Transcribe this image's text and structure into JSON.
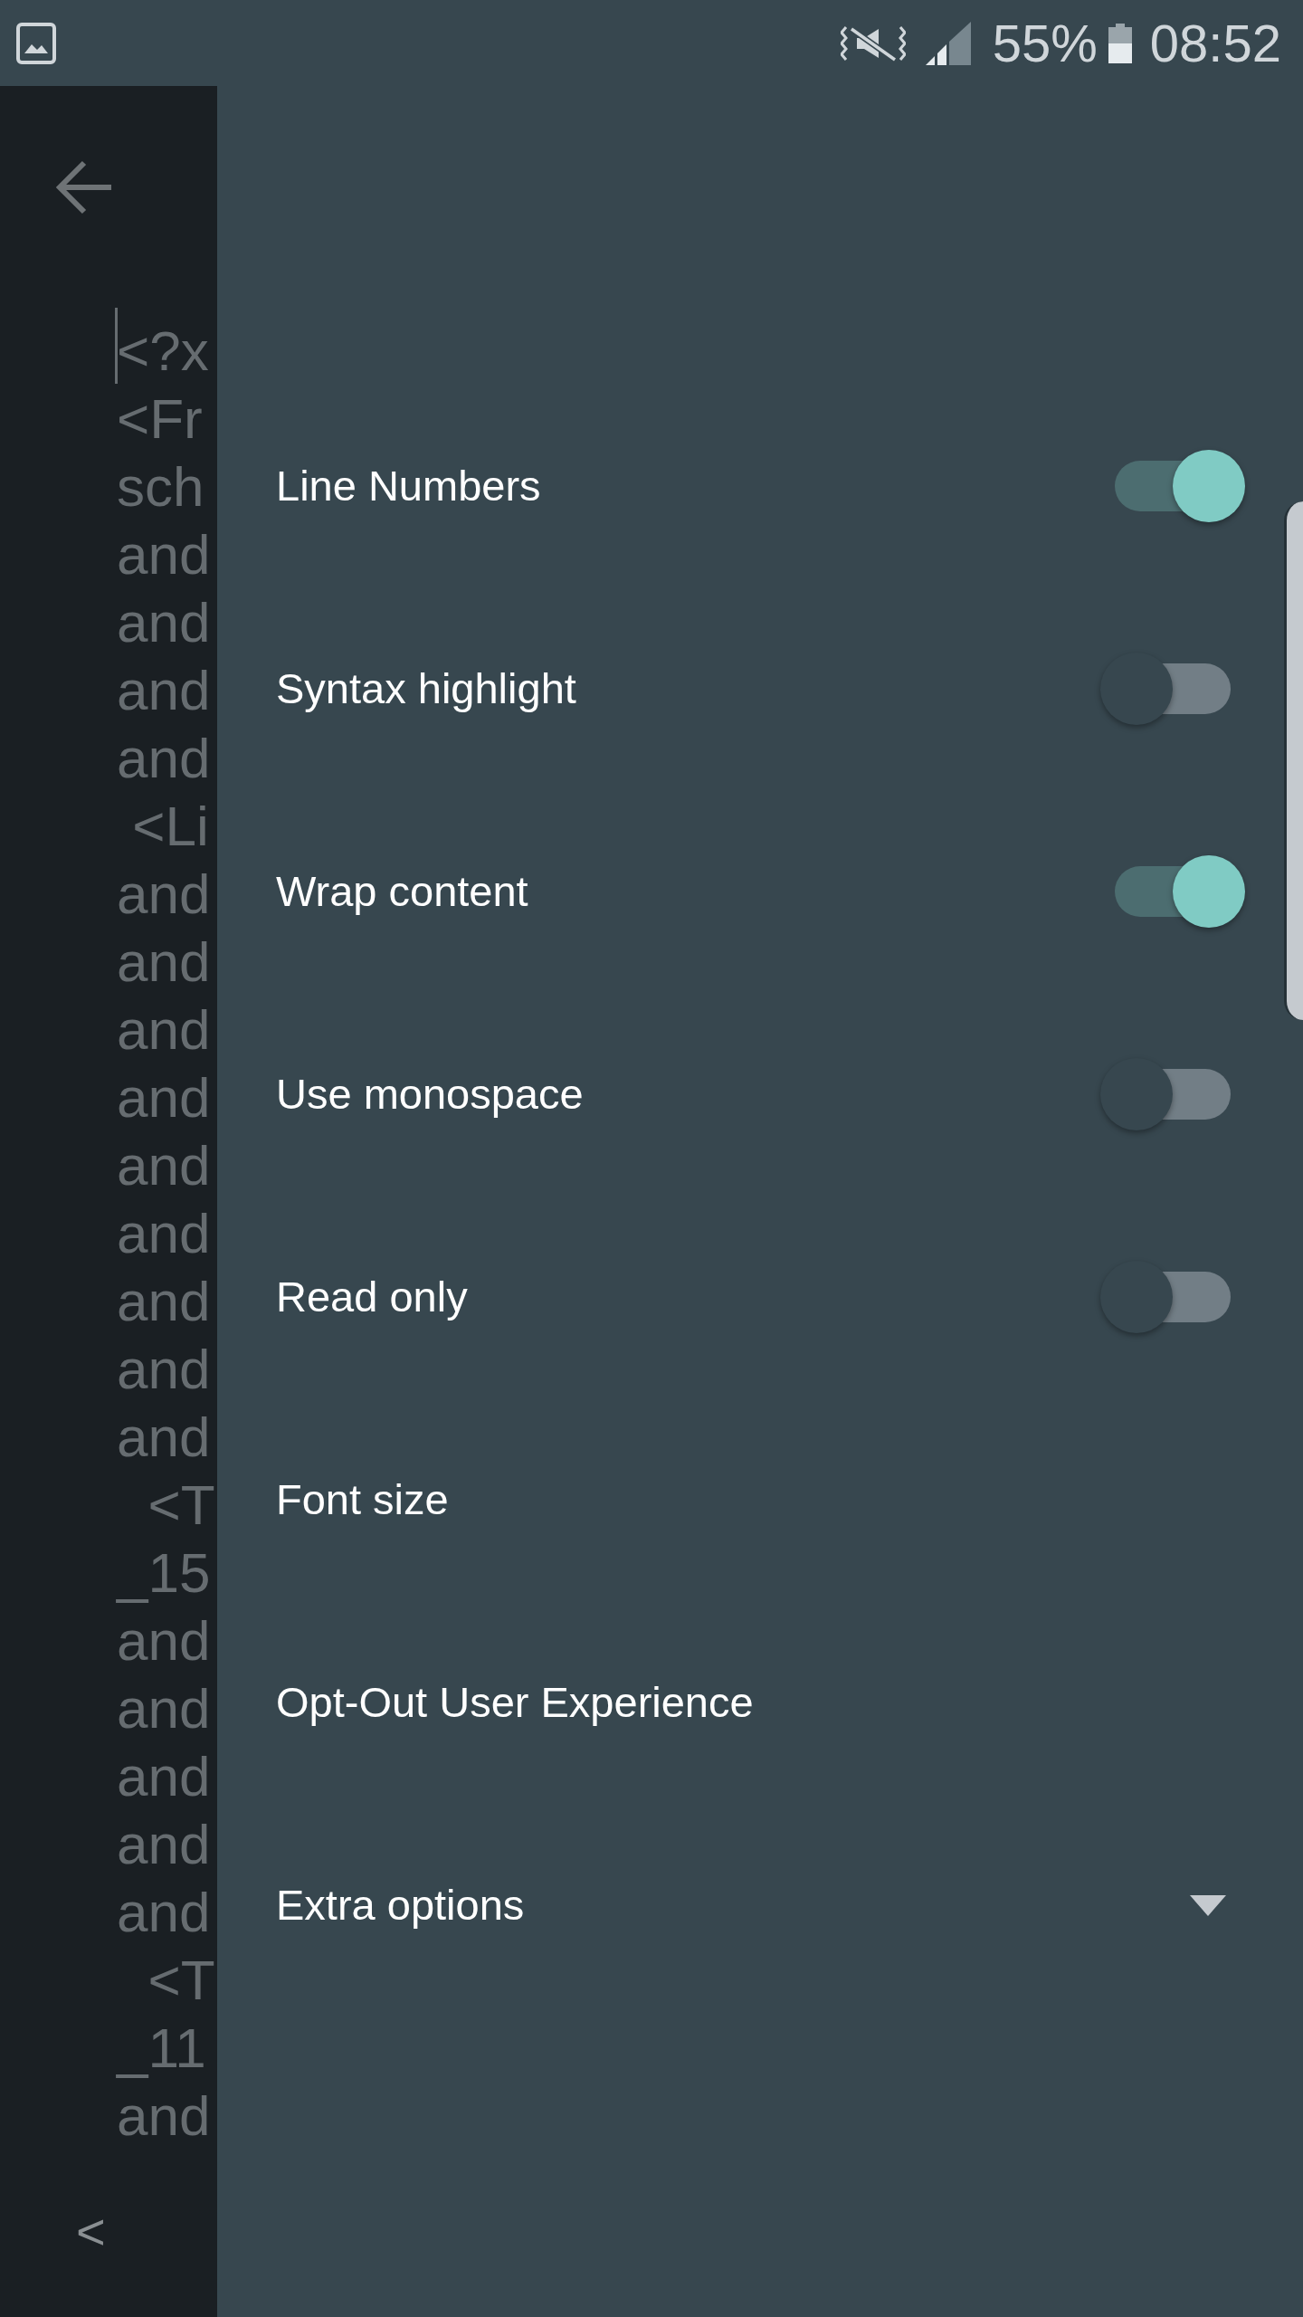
{
  "status_bar": {
    "battery": "55%",
    "time": "08:52"
  },
  "editor": {
    "lines": [
      {
        "text": "<?x",
        "cursor": true
      },
      {
        "text": "<Fr",
        "cursor": false
      },
      {
        "text": "sch",
        "cursor": false
      },
      {
        "text": "and",
        "cursor": false
      },
      {
        "text": "and",
        "cursor": false
      },
      {
        "text": "and",
        "cursor": false
      },
      {
        "text": "and",
        "cursor": false
      },
      {
        "text": " <Li",
        "cursor": false
      },
      {
        "text": "and",
        "cursor": false
      },
      {
        "text": "and",
        "cursor": false
      },
      {
        "text": "and",
        "cursor": false
      },
      {
        "text": "and",
        "cursor": false
      },
      {
        "text": "and",
        "cursor": false
      },
      {
        "text": "and",
        "cursor": false
      },
      {
        "text": "and",
        "cursor": false
      },
      {
        "text": "and",
        "cursor": false
      },
      {
        "text": "and",
        "cursor": false
      },
      {
        "text": "  <T",
        "cursor": false
      },
      {
        "text": "_15",
        "cursor": false
      },
      {
        "text": "and",
        "cursor": false
      },
      {
        "text": "and",
        "cursor": false
      },
      {
        "text": "and",
        "cursor": false
      },
      {
        "text": "and",
        "cursor": false
      },
      {
        "text": "and",
        "cursor": false
      },
      {
        "text": "  <T",
        "cursor": false
      },
      {
        "text": "_11",
        "cursor": false
      },
      {
        "text": "and",
        "cursor": false
      }
    ],
    "bottom_button": "<"
  },
  "settings": [
    {
      "kind": "switch",
      "label": "Line Numbers",
      "on": true
    },
    {
      "kind": "switch",
      "label": "Syntax highlight",
      "on": false
    },
    {
      "kind": "switch",
      "label": "Wrap content",
      "on": true
    },
    {
      "kind": "switch",
      "label": "Use monospace",
      "on": false
    },
    {
      "kind": "switch",
      "label": "Read only",
      "on": false
    },
    {
      "kind": "action",
      "label": "Font size"
    },
    {
      "kind": "action",
      "label": "Opt-Out User Experience"
    },
    {
      "kind": "expander",
      "label": "Extra options",
      "expanded": false
    }
  ]
}
